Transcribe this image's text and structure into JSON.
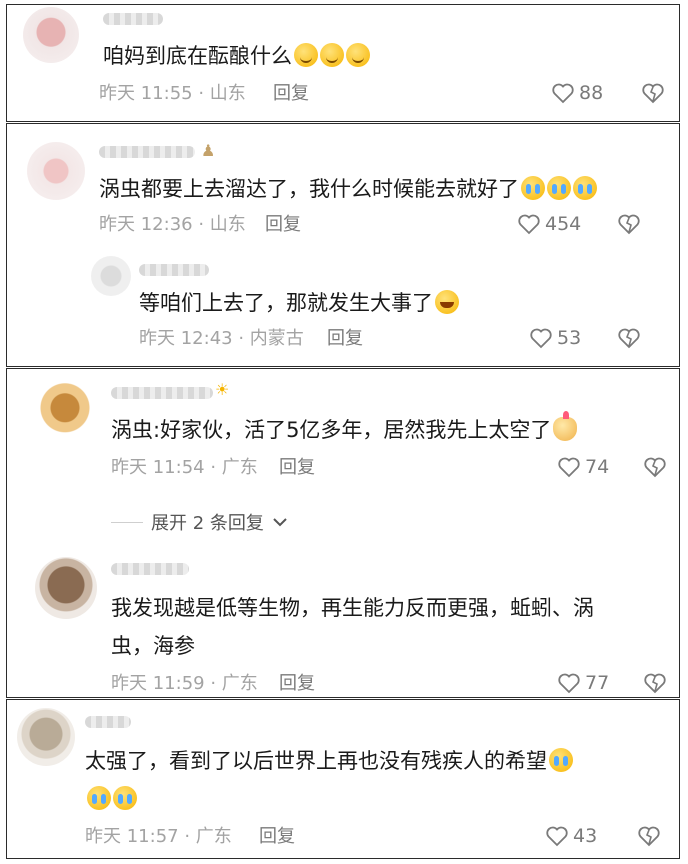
{
  "icons": {
    "like": "heart-outline-icon",
    "dislike": "broken-heart-icon",
    "expand": "chevron-down-icon"
  },
  "comments": [
    {
      "text": "咱妈到底在酝酿什么",
      "time": "昨天 11:55 · 山东",
      "reply": "回复",
      "likes": "88"
    },
    {
      "text": "涡虫都要上去溜达了，我什么时候能去就好了",
      "time": "昨天 12:36 · 山东",
      "reply": "回复",
      "likes": "454"
    },
    {
      "text": "等咱们上去了，那就发生大事了",
      "time": "昨天 12:43 · 内蒙古",
      "reply": "回复",
      "likes": "53"
    },
    {
      "text": "涡虫:好家伙，活了5亿多年，居然我先上太空了",
      "time": "昨天 11:54 · 广东",
      "reply": "回复",
      "likes": "74"
    },
    {
      "text_line1": "我发现越是低等生物，再生能力反而更强，蚯蚓、涡",
      "text_line2": "虫，海参",
      "time": "昨天 11:59 · 广东",
      "reply": "回复",
      "likes": "77"
    },
    {
      "text_line1": "太强了，看到了以后世界上再也没有残疾人的希望",
      "time": "昨天 11:57 · 广东",
      "reply": "回复",
      "likes": "43"
    }
  ],
  "expand_replies": "展开 2 条回复"
}
